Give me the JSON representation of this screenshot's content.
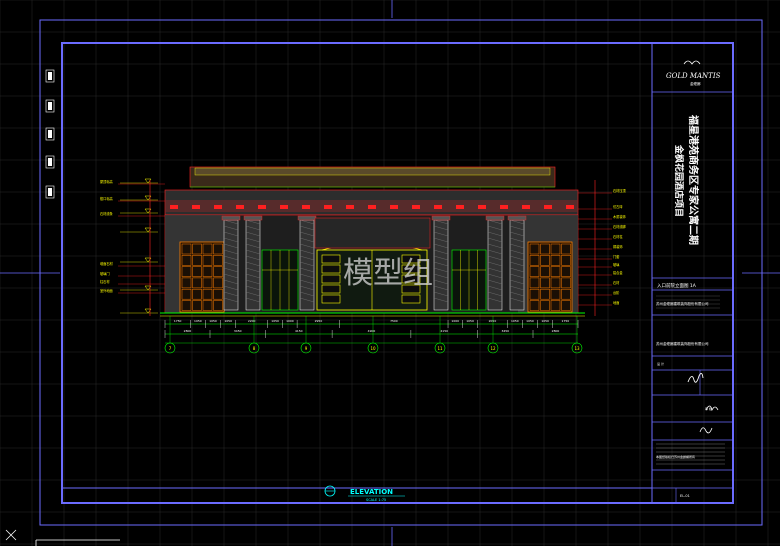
{
  "drawing": {
    "watermark": "模型组",
    "elevation_label": "ELEVATION",
    "scale_label": "SCALE 1:75"
  },
  "title_block": {
    "logo_text": "GOLD MANTIS",
    "logo_sub": "金螳螂",
    "project_name": "福星港苑商务区专家公寓二期",
    "project_sub": "金枫花园酒店项目",
    "drawing_title": "入口前院立面图 1A",
    "company_1": "苏州金螳螂建筑装饰股份有限公司",
    "company_2": "苏州金螳螂建筑装饰股份有限公司",
    "sign_label": "设 计",
    "date_label": "审 核",
    "notes": "本图纸版权归苏州金螳螂所有",
    "sheet_no": "EL-01"
  },
  "axes": {
    "grid_labels": [
      "7",
      "8",
      "9",
      "10",
      "11",
      "12",
      "13"
    ],
    "dims_top": [
      "1750",
      "1050",
      "1050",
      "1050",
      "2200",
      "1050",
      "1000",
      "2950",
      "7500",
      "1000",
      "1050",
      "2050",
      "1050",
      "1050",
      "1050",
      "1750"
    ],
    "dims_bottom": [
      "2800",
      "3450",
      "4150",
      "4900",
      "4150",
      "3450",
      "2800"
    ]
  },
  "left_notes": [
    "屋顶标高",
    "檐口标高",
    "石材线条",
    "墙面石材",
    "玻璃门",
    "柱石材",
    "室外地面"
  ],
  "right_notes": [
    "石材压顶",
    "仿古砖",
    "木质装饰",
    "石材线脚",
    "石材柱",
    "铜装饰",
    "门套",
    "玻璃",
    "铝合金",
    "石材",
    "台阶",
    "地面"
  ],
  "colors": {
    "frame": "#6b6bff",
    "grid": "#2a2a2a",
    "red": "#ff2020",
    "yellow": "#ffff00",
    "green": "#00ff00",
    "cyan": "#00ffff",
    "white": "#ffffff",
    "orange": "#ff7f00"
  }
}
